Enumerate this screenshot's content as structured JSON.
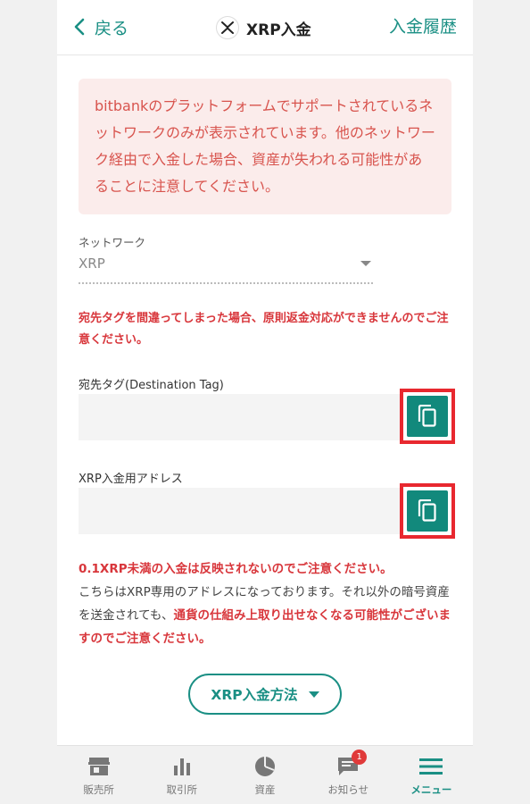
{
  "header": {
    "back_label": "戻る",
    "title": "XRP入金",
    "history_label": "入金履歴"
  },
  "warning": {
    "text": "bitbankのプラットフォームでサポートされているネットワークのみが表示されています。他のネットワーク経由で入金した場合、資産が失われる可能性があることに注意してください。"
  },
  "network": {
    "label": "ネットワーク",
    "value": "XRP"
  },
  "tag_warning": "宛先タグを間違ってしまった場合、原則返金対応ができませんのでご注意ください。",
  "destination_tag": {
    "label": "宛先タグ(Destination Tag)",
    "value": ""
  },
  "address": {
    "label": "XRP入金用アドレス",
    "value": ""
  },
  "info": {
    "line1": "0.1XRP未満の入金は反映されないのでご注意ください。",
    "line2": "こちらはXRP専用のアドレスになっております。それ以外の暗号資産を送金されても、",
    "line3": "通貨の仕組み上取り出せなくなる可能性がございますのでご注意ください。"
  },
  "method_button": "XRP入金方法",
  "tabs": [
    {
      "label": "販売所",
      "icon": "store-icon"
    },
    {
      "label": "取引所",
      "icon": "bar-chart-icon"
    },
    {
      "label": "資産",
      "icon": "pie-chart-icon"
    },
    {
      "label": "お知らせ",
      "icon": "chat-icon",
      "badge": "1"
    },
    {
      "label": "メニュー",
      "icon": "menu-icon"
    }
  ],
  "colors": {
    "accent": "#1a8f84",
    "warning_text": "#d8544e",
    "warning_bg": "#fbeceb",
    "alert_red": "#d8363b",
    "highlight_border": "#e8282f"
  }
}
